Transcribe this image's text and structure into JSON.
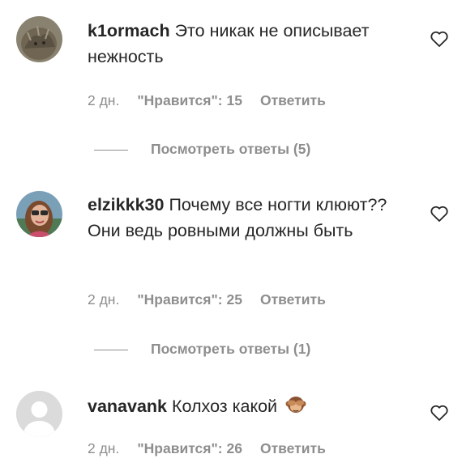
{
  "comments": [
    {
      "username": "k1ormach",
      "text": "Это никак не описывает нежность",
      "time": "2 дн.",
      "likes": "\"Нравится\": 15",
      "reply": "Ответить",
      "view_replies": "Посмотреть ответы (5)",
      "avatar": "avatar-photo-animal"
    },
    {
      "username": "elzikkk30",
      "text": "Почему все ногти клюют?? Они ведь ровными должны быть",
      "time": "2 дн.",
      "likes": "\"Нравится\": 25",
      "reply": "Ответить",
      "view_replies": "Посмотреть ответы (1)",
      "avatar": "avatar-photo-woman"
    },
    {
      "username": "vanavank",
      "text": "Колхоз какой",
      "emoji": "see-no-evil-monkey-icon",
      "time": "2 дн.",
      "likes": "\"Нравится\": 26",
      "reply": "Ответить",
      "avatar": "avatar-default"
    }
  ],
  "colors": {
    "text": "#262626",
    "secondary": "#8e8e8e"
  }
}
